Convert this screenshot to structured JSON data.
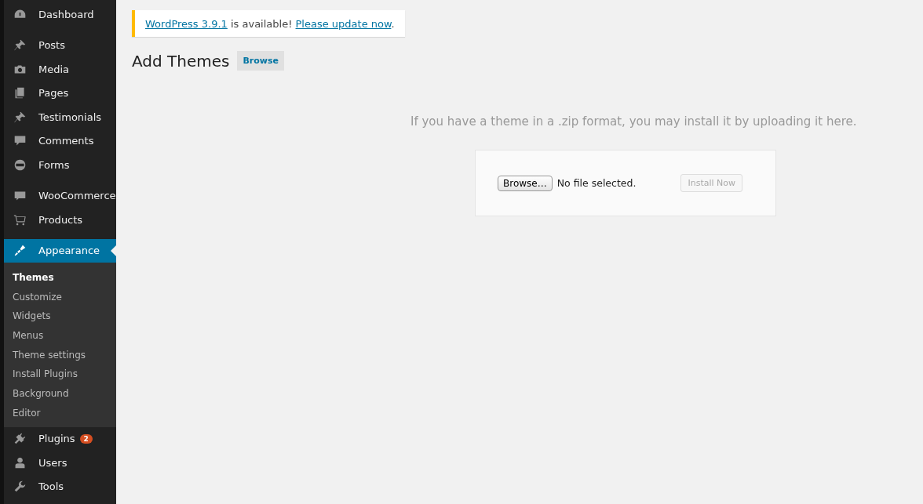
{
  "sidebar": {
    "groups": [
      [
        {
          "label": "Dashboard",
          "selected": false
        }
      ],
      [
        {
          "label": "Posts",
          "selected": false
        },
        {
          "label": "Media",
          "selected": false
        },
        {
          "label": "Pages",
          "selected": false
        },
        {
          "label": "Testimonials",
          "selected": false
        },
        {
          "label": "Comments",
          "selected": false
        },
        {
          "label": "Forms",
          "selected": false
        }
      ],
      [
        {
          "label": "WooCommerce",
          "selected": false
        },
        {
          "label": "Products",
          "selected": false
        }
      ],
      [
        {
          "label": "Appearance",
          "selected": true,
          "submenu": [
            {
              "label": "Themes",
              "selected": true
            },
            {
              "label": "Customize",
              "selected": false
            },
            {
              "label": "Widgets",
              "selected": false
            },
            {
              "label": "Menus",
              "selected": false
            },
            {
              "label": "Theme settings",
              "selected": false
            },
            {
              "label": "Install Plugins",
              "selected": false
            },
            {
              "label": "Background",
              "selected": false
            },
            {
              "label": "Editor",
              "selected": false
            }
          ]
        },
        {
          "label": "Plugins",
          "selected": false,
          "badge": "2"
        },
        {
          "label": "Users",
          "selected": false
        },
        {
          "label": "Tools",
          "selected": false
        }
      ]
    ]
  },
  "notice": {
    "link": "WordPress 3.9.1",
    "text": " is available! ",
    "action": "Please update now",
    "end": "."
  },
  "heading": {
    "title": "Add Themes",
    "button": "Browse"
  },
  "upload": {
    "description": "If you have a theme in a .zip format, you may install it by uploading it here.",
    "file_button": "Browse…",
    "file_status": "No file selected.",
    "install_button": {
      "label": "Install Now",
      "disabled": true
    }
  }
}
